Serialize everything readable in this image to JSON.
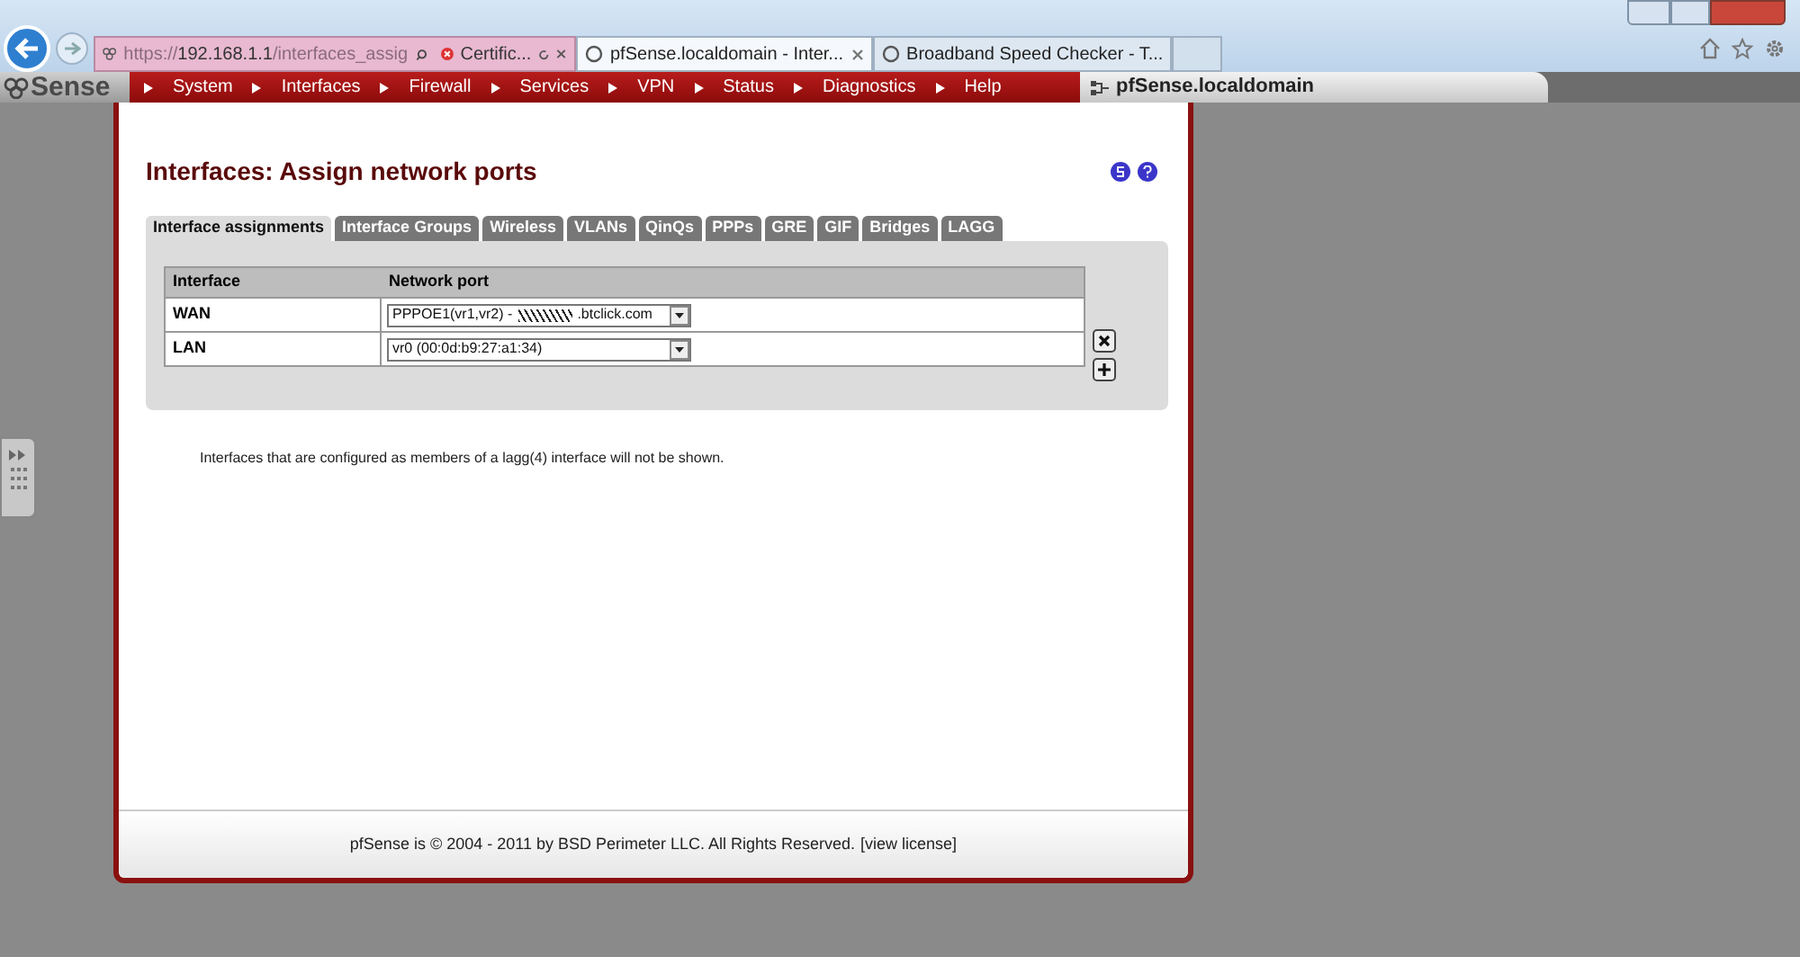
{
  "browser": {
    "url_scheme": "https://",
    "url_host": "192.168.1.1",
    "url_path": "/interfaces_assig",
    "certificate": "Certific...",
    "tabs": [
      {
        "title": "pfSense.localdomain - Inter...",
        "selected": true
      },
      {
        "title": "Broadband Speed Checker - T...",
        "selected": false
      }
    ]
  },
  "nav": {
    "logo": "Sense",
    "items": [
      "System",
      "Interfaces",
      "Firewall",
      "Services",
      "VPN",
      "Status",
      "Diagnostics",
      "Help"
    ],
    "hostname": "pfSense.localdomain"
  },
  "page": {
    "title": "Interfaces: Assign network ports",
    "tabs": [
      {
        "label": "Interface assignments",
        "selected": true
      },
      {
        "label": "Interface Groups",
        "selected": false
      },
      {
        "label": "Wireless",
        "selected": false
      },
      {
        "label": "VLANs",
        "selected": false
      },
      {
        "label": "QinQs",
        "selected": false
      },
      {
        "label": "PPPs",
        "selected": false
      },
      {
        "label": "GRE",
        "selected": false
      },
      {
        "label": "GIF",
        "selected": false
      },
      {
        "label": "Bridges",
        "selected": false
      },
      {
        "label": "LAGG",
        "selected": false
      }
    ],
    "columns": [
      "Interface",
      "Network port"
    ],
    "rows": [
      {
        "interface": "WAN",
        "port_start": "PPPOE1(vr1,vr2) -",
        "redacted": true,
        "port_end": ".btclick.com",
        "delete": false
      },
      {
        "interface": "LAN",
        "port_start": "vr0 (00:0d:b9:27:a1:34)",
        "redacted": false,
        "port_end": "",
        "delete": true
      }
    ],
    "note": "Interfaces that are configured as members of a lagg(4) interface will not be shown.",
    "footer": {
      "text": "pfSense is © 2004 - 2011 by BSD Perimeter LLC. All Rights Reserved.",
      "link": "[view license]"
    }
  }
}
